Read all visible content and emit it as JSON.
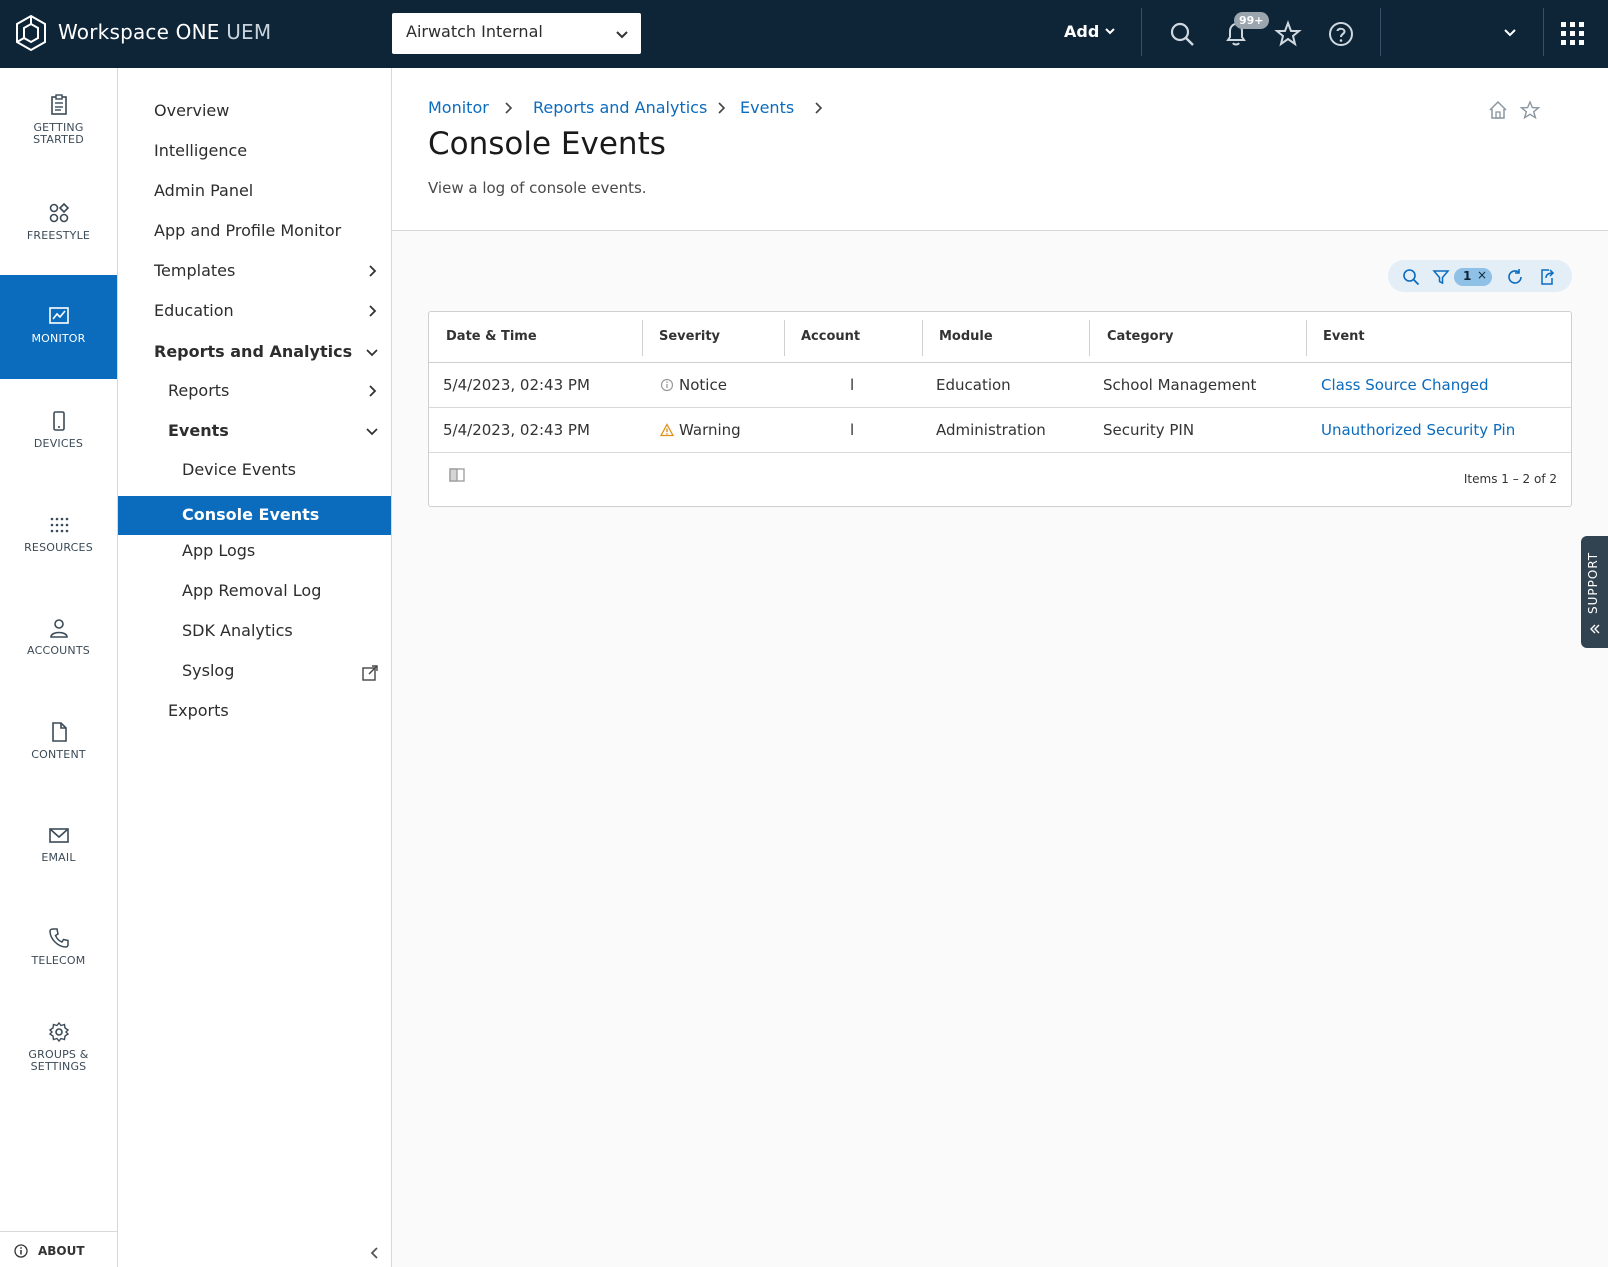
{
  "header": {
    "brand_main": "Workspace ONE",
    "brand_sub": "UEM",
    "org_selector_value": "Airwatch Internal",
    "add_label": "Add",
    "notification_count": "99+"
  },
  "rail": {
    "items": [
      {
        "label_line1": "GETTING",
        "label_line2": "STARTED"
      },
      {
        "label_line1": "FREESTYLE",
        "label_line2": ""
      },
      {
        "label_line1": "MONITOR",
        "label_line2": ""
      },
      {
        "label_line1": "DEVICES",
        "label_line2": ""
      },
      {
        "label_line1": "RESOURCES",
        "label_line2": ""
      },
      {
        "label_line1": "ACCOUNTS",
        "label_line2": ""
      },
      {
        "label_line1": "CONTENT",
        "label_line2": ""
      },
      {
        "label_line1": "EMAIL",
        "label_line2": ""
      },
      {
        "label_line1": "TELECOM",
        "label_line2": ""
      },
      {
        "label_line1": "GROUPS &",
        "label_line2": "SETTINGS"
      }
    ],
    "about_label": "ABOUT"
  },
  "nav": {
    "items": [
      {
        "label": "Overview"
      },
      {
        "label": "Intelligence"
      },
      {
        "label": "Admin Panel"
      },
      {
        "label": "App and Profile Monitor"
      },
      {
        "label": "Templates"
      },
      {
        "label": "Education"
      },
      {
        "label": "Reports and Analytics"
      },
      {
        "label": "Reports"
      },
      {
        "label": "Events"
      },
      {
        "label": "Device Events"
      },
      {
        "label": "Console Events"
      },
      {
        "label": "App Logs"
      },
      {
        "label": "App Removal Log"
      },
      {
        "label": "SDK Analytics"
      },
      {
        "label": "Syslog"
      },
      {
        "label": "Exports"
      }
    ]
  },
  "page": {
    "breadcrumbs": [
      "Monitor",
      "Reports and Analytics",
      "Events"
    ],
    "title": "Console Events",
    "description": "View a log of console events."
  },
  "toolbar": {
    "filter_count": "1"
  },
  "grid": {
    "columns": [
      "Date & Time",
      "Severity",
      "Account",
      "Module",
      "Category",
      "Event"
    ],
    "rows": [
      {
        "datetime": "5/4/2023, 02:43 PM",
        "severity": "Notice",
        "account": "l",
        "module": "Education",
        "category": "School Management",
        "event": "Class Source Changed"
      },
      {
        "datetime": "5/4/2023, 02:43 PM",
        "severity": "Warning",
        "account": "l",
        "module": "Administration",
        "category": "Security PIN",
        "event": "Unauthorized Security Pin"
      }
    ],
    "items_count": "Items 1 – 2 of 2"
  },
  "support_label": "SUPPORT"
}
